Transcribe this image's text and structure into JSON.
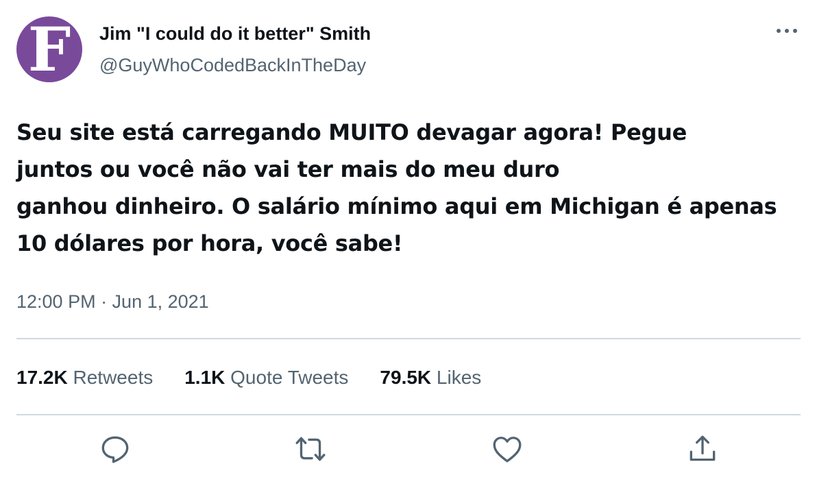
{
  "author": {
    "avatar_letter": "F",
    "avatar_color": "#7a4a9a",
    "display_name": "Jim \"I could do it better\" Smith",
    "handle": "@GuyWhoCodedBackInTheDay"
  },
  "tweet": {
    "lines": [
      "Seu site está carregando MUITO devagar agora! Pegue",
      "juntos ou você não vai ter mais do meu duro",
      "ganhou dinheiro. O salário mínimo aqui em Michigan é apenas",
      "10 dólares por hora, você sabe!"
    ],
    "timestamp": "12:00 PM · Jun 1, 2021"
  },
  "stats": {
    "retweets_count": "17.2K",
    "retweets_label": "Retweets",
    "quotes_count": "1.1K",
    "quotes_label": "Quote Tweets",
    "likes_count": "79.5K",
    "likes_label": "Likes"
  },
  "actions": [
    "reply-icon",
    "retweet-icon",
    "like-icon",
    "share-icon"
  ],
  "colors": {
    "text": "#0f1419",
    "secondary": "#536471",
    "divider": "#cfd9de"
  }
}
